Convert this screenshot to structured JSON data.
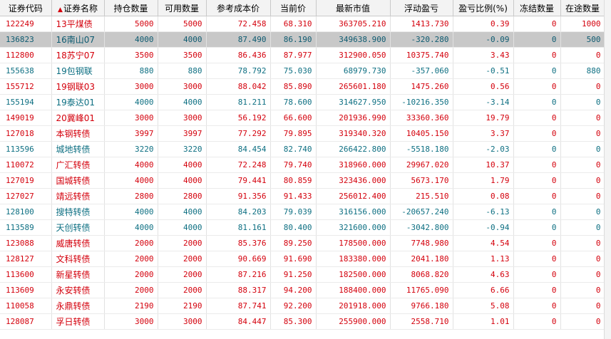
{
  "columns": {
    "code": "证券代码",
    "name": "证券名称",
    "holding": "持仓数量",
    "available": "可用数量",
    "cost": "参考成本价",
    "price": "当前价",
    "market_value": "最新市值",
    "pnl": "浮动盈亏",
    "pnl_ratio": "盈亏比例(%)",
    "frozen": "冻结数量",
    "in_transit": "在途数量"
  },
  "sort_column": "name",
  "colors": {
    "up": "#d4000c",
    "down": "#0d6f82",
    "selected_bg": "#c8c8c8"
  },
  "rows": [
    {
      "code": "122249",
      "name": "13平煤债",
      "holding": "5000",
      "available": "5000",
      "cost": "72.458",
      "price": "68.310",
      "market_value": "363705.210",
      "pnl": "1413.730",
      "pnl_ratio": "0.39",
      "frozen": "0",
      "in_transit": "1000",
      "trend": "up"
    },
    {
      "code": "136823",
      "name": "16南山07",
      "holding": "4000",
      "available": "4000",
      "cost": "87.490",
      "price": "86.190",
      "market_value": "349638.900",
      "pnl": "-320.280",
      "pnl_ratio": "-0.09",
      "frozen": "0",
      "in_transit": "500",
      "trend": "down",
      "selected": true
    },
    {
      "code": "112800",
      "name": "18苏宁07",
      "holding": "3500",
      "available": "3500",
      "cost": "86.436",
      "price": "87.977",
      "market_value": "312900.050",
      "pnl": "10375.740",
      "pnl_ratio": "3.43",
      "frozen": "0",
      "in_transit": "0",
      "trend": "up"
    },
    {
      "code": "155638",
      "name": "19包钢联",
      "holding": "880",
      "available": "880",
      "cost": "78.792",
      "price": "75.030",
      "market_value": "68979.730",
      "pnl": "-357.060",
      "pnl_ratio": "-0.51",
      "frozen": "0",
      "in_transit": "880",
      "trend": "down"
    },
    {
      "code": "155712",
      "name": "19钢联03",
      "holding": "3000",
      "available": "3000",
      "cost": "88.042",
      "price": "85.890",
      "market_value": "265601.180",
      "pnl": "1475.260",
      "pnl_ratio": "0.56",
      "frozen": "0",
      "in_transit": "0",
      "trend": "up"
    },
    {
      "code": "155194",
      "name": "19泰达01",
      "holding": "4000",
      "available": "4000",
      "cost": "81.211",
      "price": "78.600",
      "market_value": "314627.950",
      "pnl": "-10216.350",
      "pnl_ratio": "-3.14",
      "frozen": "0",
      "in_transit": "0",
      "trend": "down"
    },
    {
      "code": "149019",
      "name": "20冀峰01",
      "holding": "3000",
      "available": "3000",
      "cost": "56.192",
      "price": "66.600",
      "market_value": "201936.990",
      "pnl": "33360.360",
      "pnl_ratio": "19.79",
      "frozen": "0",
      "in_transit": "0",
      "trend": "up"
    },
    {
      "code": "127018",
      "name": "本钢转债",
      "holding": "3997",
      "available": "3997",
      "cost": "77.292",
      "price": "79.895",
      "market_value": "319340.320",
      "pnl": "10405.150",
      "pnl_ratio": "3.37",
      "frozen": "0",
      "in_transit": "0",
      "trend": "up"
    },
    {
      "code": "113596",
      "name": "城地转债",
      "holding": "3220",
      "available": "3220",
      "cost": "84.454",
      "price": "82.740",
      "market_value": "266422.800",
      "pnl": "-5518.180",
      "pnl_ratio": "-2.03",
      "frozen": "0",
      "in_transit": "0",
      "trend": "down"
    },
    {
      "code": "110072",
      "name": "广汇转债",
      "holding": "4000",
      "available": "4000",
      "cost": "72.248",
      "price": "79.740",
      "market_value": "318960.000",
      "pnl": "29967.020",
      "pnl_ratio": "10.37",
      "frozen": "0",
      "in_transit": "0",
      "trend": "up"
    },
    {
      "code": "127019",
      "name": "国城转债",
      "holding": "4000",
      "available": "4000",
      "cost": "79.441",
      "price": "80.859",
      "market_value": "323436.000",
      "pnl": "5673.170",
      "pnl_ratio": "1.79",
      "frozen": "0",
      "in_transit": "0",
      "trend": "up"
    },
    {
      "code": "127027",
      "name": "靖远转债",
      "holding": "2800",
      "available": "2800",
      "cost": "91.356",
      "price": "91.433",
      "market_value": "256012.400",
      "pnl": "215.510",
      "pnl_ratio": "0.08",
      "frozen": "0",
      "in_transit": "0",
      "trend": "up"
    },
    {
      "code": "128100",
      "name": "搜特转债",
      "holding": "4000",
      "available": "4000",
      "cost": "84.203",
      "price": "79.039",
      "market_value": "316156.000",
      "pnl": "-20657.240",
      "pnl_ratio": "-6.13",
      "frozen": "0",
      "in_transit": "0",
      "trend": "down"
    },
    {
      "code": "113589",
      "name": "天创转债",
      "holding": "4000",
      "available": "4000",
      "cost": "81.161",
      "price": "80.400",
      "market_value": "321600.000",
      "pnl": "-3042.800",
      "pnl_ratio": "-0.94",
      "frozen": "0",
      "in_transit": "0",
      "trend": "down"
    },
    {
      "code": "123088",
      "name": "威唐转债",
      "holding": "2000",
      "available": "2000",
      "cost": "85.376",
      "price": "89.250",
      "market_value": "178500.000",
      "pnl": "7748.980",
      "pnl_ratio": "4.54",
      "frozen": "0",
      "in_transit": "0",
      "trend": "up"
    },
    {
      "code": "128127",
      "name": "文科转债",
      "holding": "2000",
      "available": "2000",
      "cost": "90.669",
      "price": "91.690",
      "market_value": "183380.000",
      "pnl": "2041.180",
      "pnl_ratio": "1.13",
      "frozen": "0",
      "in_transit": "0",
      "trend": "up"
    },
    {
      "code": "113600",
      "name": "新星转债",
      "holding": "2000",
      "available": "2000",
      "cost": "87.216",
      "price": "91.250",
      "market_value": "182500.000",
      "pnl": "8068.820",
      "pnl_ratio": "4.63",
      "frozen": "0",
      "in_transit": "0",
      "trend": "up"
    },
    {
      "code": "113609",
      "name": "永安转债",
      "holding": "2000",
      "available": "2000",
      "cost": "88.317",
      "price": "94.200",
      "market_value": "188400.000",
      "pnl": "11765.090",
      "pnl_ratio": "6.66",
      "frozen": "0",
      "in_transit": "0",
      "trend": "up"
    },
    {
      "code": "110058",
      "name": "永鼎转债",
      "holding": "2190",
      "available": "2190",
      "cost": "87.741",
      "price": "92.200",
      "market_value": "201918.000",
      "pnl": "9766.180",
      "pnl_ratio": "5.08",
      "frozen": "0",
      "in_transit": "0",
      "trend": "up"
    },
    {
      "code": "128087",
      "name": "孚日转债",
      "holding": "3000",
      "available": "3000",
      "cost": "84.447",
      "price": "85.300",
      "market_value": "255900.000",
      "pnl": "2558.710",
      "pnl_ratio": "1.01",
      "frozen": "0",
      "in_transit": "0",
      "trend": "up"
    }
  ]
}
